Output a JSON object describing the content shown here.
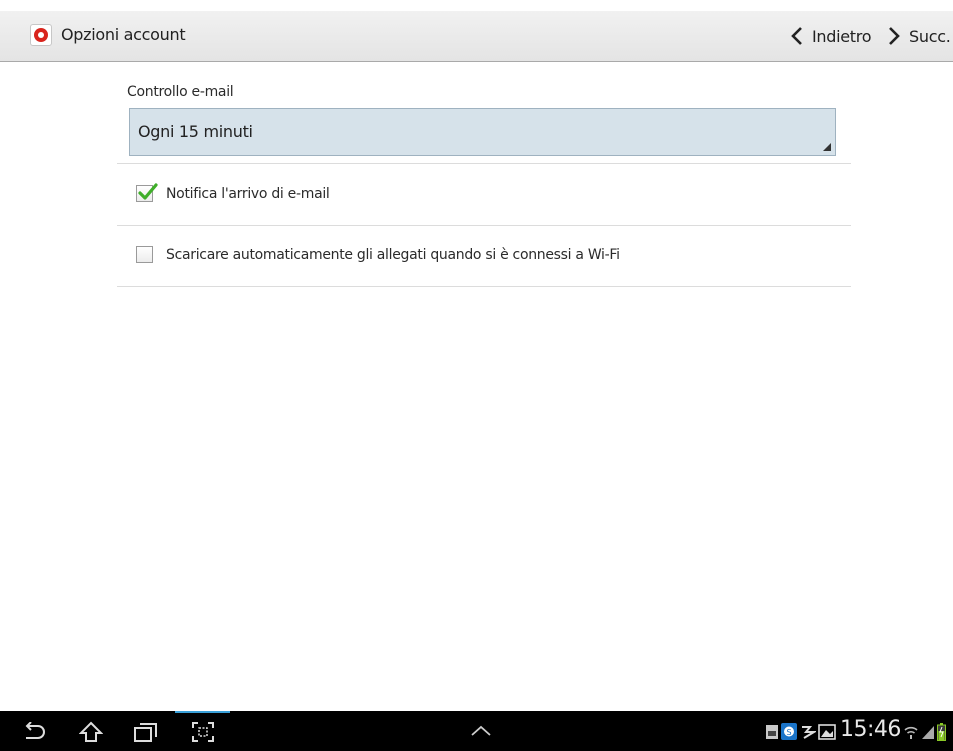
{
  "action_bar": {
    "title": "Opzioni account",
    "back_label": "Indietro",
    "next_label": "Succ."
  },
  "settings": {
    "check_mail_label": "Controllo e-mail",
    "check_mail_value": "Ogni 15 minuti",
    "items": [
      {
        "label": "Notifica l'arrivo di e-mail",
        "checked": true
      },
      {
        "label": "Scaricare automaticamente gli allegati quando si è connessi a Wi-Fi",
        "checked": false
      }
    ]
  },
  "system_bar": {
    "clock": "15:46",
    "icons": [
      "back-icon",
      "home-icon",
      "recent-apps-icon",
      "screenshot-icon",
      "up-arrow-icon",
      "notification-icons",
      "wifi-icon",
      "signal-icon",
      "battery-icon"
    ]
  },
  "colors": {
    "accent_select": "#d6e2ea",
    "check_green": "#3fae2a",
    "app_icon_red": "#d9241c",
    "highlight_blue": "#3aa0d8"
  }
}
